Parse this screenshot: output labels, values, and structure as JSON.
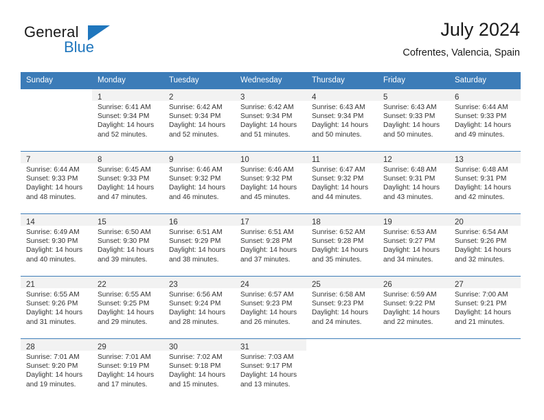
{
  "brand": {
    "name_part1": "General",
    "name_part2": "Blue",
    "triangle_color": "#1f76bd",
    "blue_hex": "#1f76bd"
  },
  "header": {
    "title": "July 2024",
    "subtitle": "Cofrentes, Valencia, Spain"
  },
  "theme": {
    "header_bg": "#3c7cb8",
    "daynum_band_bg": "#f2f2f2",
    "text_color": "#333333",
    "page_bg": "#ffffff"
  },
  "weekdays": [
    "Sunday",
    "Monday",
    "Tuesday",
    "Wednesday",
    "Thursday",
    "Friday",
    "Saturday"
  ],
  "weeks": [
    [
      {
        "day": "",
        "lines": []
      },
      {
        "day": "1",
        "lines": [
          "Sunrise: 6:41 AM",
          "Sunset: 9:34 PM",
          "Daylight: 14 hours",
          "and 52 minutes."
        ]
      },
      {
        "day": "2",
        "lines": [
          "Sunrise: 6:42 AM",
          "Sunset: 9:34 PM",
          "Daylight: 14 hours",
          "and 52 minutes."
        ]
      },
      {
        "day": "3",
        "lines": [
          "Sunrise: 6:42 AM",
          "Sunset: 9:34 PM",
          "Daylight: 14 hours",
          "and 51 minutes."
        ]
      },
      {
        "day": "4",
        "lines": [
          "Sunrise: 6:43 AM",
          "Sunset: 9:34 PM",
          "Daylight: 14 hours",
          "and 50 minutes."
        ]
      },
      {
        "day": "5",
        "lines": [
          "Sunrise: 6:43 AM",
          "Sunset: 9:33 PM",
          "Daylight: 14 hours",
          "and 50 minutes."
        ]
      },
      {
        "day": "6",
        "lines": [
          "Sunrise: 6:44 AM",
          "Sunset: 9:33 PM",
          "Daylight: 14 hours",
          "and 49 minutes."
        ]
      }
    ],
    [
      {
        "day": "7",
        "lines": [
          "Sunrise: 6:44 AM",
          "Sunset: 9:33 PM",
          "Daylight: 14 hours",
          "and 48 minutes."
        ]
      },
      {
        "day": "8",
        "lines": [
          "Sunrise: 6:45 AM",
          "Sunset: 9:33 PM",
          "Daylight: 14 hours",
          "and 47 minutes."
        ]
      },
      {
        "day": "9",
        "lines": [
          "Sunrise: 6:46 AM",
          "Sunset: 9:32 PM",
          "Daylight: 14 hours",
          "and 46 minutes."
        ]
      },
      {
        "day": "10",
        "lines": [
          "Sunrise: 6:46 AM",
          "Sunset: 9:32 PM",
          "Daylight: 14 hours",
          "and 45 minutes."
        ]
      },
      {
        "day": "11",
        "lines": [
          "Sunrise: 6:47 AM",
          "Sunset: 9:32 PM",
          "Daylight: 14 hours",
          "and 44 minutes."
        ]
      },
      {
        "day": "12",
        "lines": [
          "Sunrise: 6:48 AM",
          "Sunset: 9:31 PM",
          "Daylight: 14 hours",
          "and 43 minutes."
        ]
      },
      {
        "day": "13",
        "lines": [
          "Sunrise: 6:48 AM",
          "Sunset: 9:31 PM",
          "Daylight: 14 hours",
          "and 42 minutes."
        ]
      }
    ],
    [
      {
        "day": "14",
        "lines": [
          "Sunrise: 6:49 AM",
          "Sunset: 9:30 PM",
          "Daylight: 14 hours",
          "and 40 minutes."
        ]
      },
      {
        "day": "15",
        "lines": [
          "Sunrise: 6:50 AM",
          "Sunset: 9:30 PM",
          "Daylight: 14 hours",
          "and 39 minutes."
        ]
      },
      {
        "day": "16",
        "lines": [
          "Sunrise: 6:51 AM",
          "Sunset: 9:29 PM",
          "Daylight: 14 hours",
          "and 38 minutes."
        ]
      },
      {
        "day": "17",
        "lines": [
          "Sunrise: 6:51 AM",
          "Sunset: 9:28 PM",
          "Daylight: 14 hours",
          "and 37 minutes."
        ]
      },
      {
        "day": "18",
        "lines": [
          "Sunrise: 6:52 AM",
          "Sunset: 9:28 PM",
          "Daylight: 14 hours",
          "and 35 minutes."
        ]
      },
      {
        "day": "19",
        "lines": [
          "Sunrise: 6:53 AM",
          "Sunset: 9:27 PM",
          "Daylight: 14 hours",
          "and 34 minutes."
        ]
      },
      {
        "day": "20",
        "lines": [
          "Sunrise: 6:54 AM",
          "Sunset: 9:26 PM",
          "Daylight: 14 hours",
          "and 32 minutes."
        ]
      }
    ],
    [
      {
        "day": "21",
        "lines": [
          "Sunrise: 6:55 AM",
          "Sunset: 9:26 PM",
          "Daylight: 14 hours",
          "and 31 minutes."
        ]
      },
      {
        "day": "22",
        "lines": [
          "Sunrise: 6:55 AM",
          "Sunset: 9:25 PM",
          "Daylight: 14 hours",
          "and 29 minutes."
        ]
      },
      {
        "day": "23",
        "lines": [
          "Sunrise: 6:56 AM",
          "Sunset: 9:24 PM",
          "Daylight: 14 hours",
          "and 28 minutes."
        ]
      },
      {
        "day": "24",
        "lines": [
          "Sunrise: 6:57 AM",
          "Sunset: 9:23 PM",
          "Daylight: 14 hours",
          "and 26 minutes."
        ]
      },
      {
        "day": "25",
        "lines": [
          "Sunrise: 6:58 AM",
          "Sunset: 9:23 PM",
          "Daylight: 14 hours",
          "and 24 minutes."
        ]
      },
      {
        "day": "26",
        "lines": [
          "Sunrise: 6:59 AM",
          "Sunset: 9:22 PM",
          "Daylight: 14 hours",
          "and 22 minutes."
        ]
      },
      {
        "day": "27",
        "lines": [
          "Sunrise: 7:00 AM",
          "Sunset: 9:21 PM",
          "Daylight: 14 hours",
          "and 21 minutes."
        ]
      }
    ],
    [
      {
        "day": "28",
        "lines": [
          "Sunrise: 7:01 AM",
          "Sunset: 9:20 PM",
          "Daylight: 14 hours",
          "and 19 minutes."
        ]
      },
      {
        "day": "29",
        "lines": [
          "Sunrise: 7:01 AM",
          "Sunset: 9:19 PM",
          "Daylight: 14 hours",
          "and 17 minutes."
        ]
      },
      {
        "day": "30",
        "lines": [
          "Sunrise: 7:02 AM",
          "Sunset: 9:18 PM",
          "Daylight: 14 hours",
          "and 15 minutes."
        ]
      },
      {
        "day": "31",
        "lines": [
          "Sunrise: 7:03 AM",
          "Sunset: 9:17 PM",
          "Daylight: 14 hours",
          "and 13 minutes."
        ]
      },
      {
        "day": "",
        "lines": []
      },
      {
        "day": "",
        "lines": []
      },
      {
        "day": "",
        "lines": []
      }
    ]
  ]
}
